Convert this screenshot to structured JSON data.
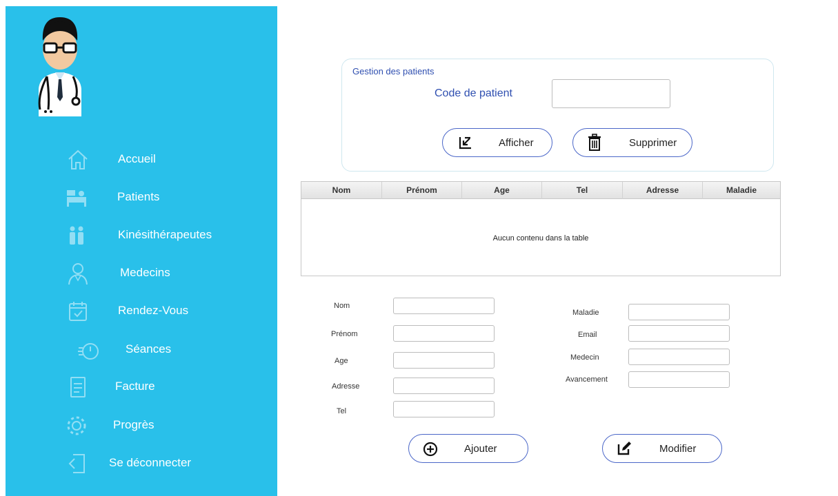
{
  "sidebar": {
    "items": [
      {
        "label": "Accueil",
        "icon": "home-icon"
      },
      {
        "label": "Patients",
        "icon": "hospital-bed-icon"
      },
      {
        "label": "Kinésithérapeutes",
        "icon": "people-icon"
      },
      {
        "label": "Medecins",
        "icon": "doctor-icon"
      },
      {
        "label": "Rendez-Vous",
        "icon": "calendar-icon"
      },
      {
        "label": "Séances",
        "icon": "stopwatch-icon"
      },
      {
        "label": "Facture",
        "icon": "invoice-icon"
      },
      {
        "label": "Progrès",
        "icon": "gear-icon"
      },
      {
        "label": "Se déconnecter",
        "icon": "logout-icon"
      }
    ]
  },
  "gestion": {
    "title": "Gestion des patients",
    "code_label": "Code de patient",
    "code_value": "",
    "afficher_label": "Afficher",
    "supprimer_label": "Supprimer"
  },
  "table": {
    "columns": [
      "Nom",
      "Prénom",
      "Age",
      "Tel",
      "Adresse",
      "Maladie"
    ],
    "rows": [],
    "empty_text": "Aucun contenu dans la table"
  },
  "form": {
    "left": [
      {
        "label": "Nom",
        "value": ""
      },
      {
        "label": "Prénom",
        "value": ""
      },
      {
        "label": "Age",
        "value": ""
      },
      {
        "label": "Adresse",
        "value": ""
      },
      {
        "label": "Tel",
        "value": ""
      }
    ],
    "right": [
      {
        "label": "Maladie",
        "value": ""
      },
      {
        "label": "Email",
        "value": ""
      },
      {
        "label": "Medecin",
        "value": ""
      },
      {
        "label": "Avancement",
        "value": ""
      }
    ],
    "ajouter_label": "Ajouter",
    "modifier_label": "Modifier"
  },
  "colors": {
    "sidebar_bg": "#29c0ea",
    "accent_blue": "#2f4fb0",
    "button_border": "#4a66c8"
  }
}
